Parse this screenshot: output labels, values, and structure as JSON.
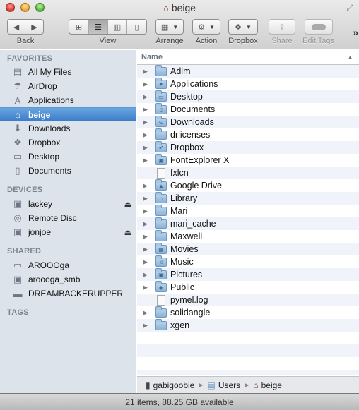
{
  "window": {
    "title": "beige",
    "title_icon": "home-icon"
  },
  "toolbar": {
    "back_label": "Back",
    "view_label": "View",
    "arrange_label": "Arrange",
    "action_label": "Action",
    "dropbox_label": "Dropbox",
    "share_label": "Share",
    "edit_tags_label": "Edit Tags",
    "view_modes": [
      {
        "name": "icon-view",
        "glyph": "⊞",
        "active": false
      },
      {
        "name": "list-view",
        "glyph": "☰",
        "active": true
      },
      {
        "name": "column-view",
        "glyph": "▥",
        "active": false
      },
      {
        "name": "cover-flow-view",
        "glyph": "▯",
        "active": false
      }
    ],
    "overflow_glyph": "»"
  },
  "sidebar": {
    "favorites_heading": "FAVORITES",
    "favorites": [
      {
        "label": "All My Files",
        "icon": "all-files-icon",
        "glyph": "▤"
      },
      {
        "label": "AirDrop",
        "icon": "airdrop-icon",
        "glyph": "☂"
      },
      {
        "label": "Applications",
        "icon": "applications-icon",
        "glyph": "A"
      },
      {
        "label": "beige",
        "icon": "home-icon",
        "glyph": "⌂",
        "selected": true
      },
      {
        "label": "Downloads",
        "icon": "downloads-icon",
        "glyph": "⬇"
      },
      {
        "label": "Dropbox",
        "icon": "dropbox-icon",
        "glyph": "❖"
      },
      {
        "label": "Desktop",
        "icon": "desktop-icon",
        "glyph": "▭"
      },
      {
        "label": "Documents",
        "icon": "documents-icon",
        "glyph": "▯"
      }
    ],
    "devices_heading": "DEVICES",
    "devices": [
      {
        "label": "lackey",
        "icon": "hard-drive-icon",
        "glyph": "▣",
        "eject": true
      },
      {
        "label": "Remote Disc",
        "icon": "disc-icon",
        "glyph": "◎",
        "eject": false
      },
      {
        "label": "jonjoe",
        "icon": "time-machine-icon",
        "glyph": "▣",
        "eject": true
      }
    ],
    "shared_heading": "SHARED",
    "shared": [
      {
        "label": "AROOOga",
        "icon": "laptop-icon",
        "glyph": "▭"
      },
      {
        "label": "aroooga_smb",
        "icon": "monitor-icon",
        "glyph": "▣"
      },
      {
        "label": "DREAMBACKERUPPER",
        "icon": "nas-icon",
        "glyph": "▬"
      }
    ],
    "tags_heading": "TAGS",
    "eject_glyph": "⏏"
  },
  "list": {
    "column_name": "Name",
    "sort_glyph": "▲",
    "items": [
      {
        "name": "Adlm",
        "type": "folder",
        "glyph": ""
      },
      {
        "name": "Applications",
        "type": "folder",
        "glyph": "✦"
      },
      {
        "name": "Desktop",
        "type": "folder",
        "glyph": "▭"
      },
      {
        "name": "Documents",
        "type": "folder",
        "glyph": "▯"
      },
      {
        "name": "Downloads",
        "type": "folder",
        "glyph": "⊙"
      },
      {
        "name": "drlicenses",
        "type": "folder",
        "glyph": ""
      },
      {
        "name": "Dropbox",
        "type": "folder",
        "glyph": "✔"
      },
      {
        "name": "FontExplorer X",
        "type": "folder",
        "glyph": "▣"
      },
      {
        "name": "fxlcn",
        "type": "file",
        "glyph": ""
      },
      {
        "name": "Google Drive",
        "type": "folder",
        "glyph": "▲"
      },
      {
        "name": "Library",
        "type": "folder",
        "glyph": "⌂"
      },
      {
        "name": "Mari",
        "type": "folder",
        "glyph": ""
      },
      {
        "name": "mari_cache",
        "type": "folder",
        "glyph": ""
      },
      {
        "name": "Maxwell",
        "type": "folder",
        "glyph": ""
      },
      {
        "name": "Movies",
        "type": "folder",
        "glyph": "▦"
      },
      {
        "name": "Music",
        "type": "folder",
        "glyph": "♫"
      },
      {
        "name": "Pictures",
        "type": "folder",
        "glyph": "▣"
      },
      {
        "name": "Public",
        "type": "folder",
        "glyph": "◈"
      },
      {
        "name": "pymel.log",
        "type": "file",
        "glyph": ""
      },
      {
        "name": "solidangle",
        "type": "folder",
        "glyph": ""
      },
      {
        "name": "xgen",
        "type": "folder",
        "glyph": ""
      }
    ]
  },
  "pathbar": {
    "segments": [
      {
        "label": "gabigoobie",
        "icon": "computer-icon",
        "glyph": "▮"
      },
      {
        "label": "Users",
        "icon": "users-folder-icon",
        "glyph": "▤"
      },
      {
        "label": "beige",
        "icon": "home-icon",
        "glyph": "⌂"
      }
    ],
    "separator": "▶"
  },
  "status": {
    "text": "21 items, 88.25 GB available"
  }
}
